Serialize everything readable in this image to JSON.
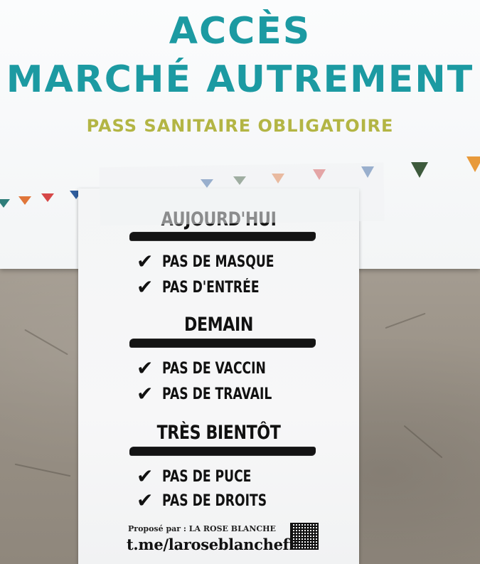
{
  "board": {
    "title_line1": "ACCÈS",
    "title_line2": "MARCHÉ AUTREMENT",
    "subtitle": "PASS SANITAIRE OBLIGATOIRE"
  },
  "flyer": {
    "sections": [
      {
        "heading": "AUJOURD'HUI",
        "items": [
          "PAS DE MASQUE",
          "PAS D'ENTRÉE"
        ]
      },
      {
        "heading": "DEMAIN",
        "items": [
          "PAS DE VACCIN",
          "PAS DE TRAVAIL"
        ]
      },
      {
        "heading": "TRÈS BIENTÔT",
        "items": [
          "PAS DE PUCE",
          "PAS DE DROITS"
        ]
      }
    ],
    "credit": "Proposé par : LA ROSE BLANCHE",
    "handle": "t.me/laroseblanchefr"
  },
  "colors": {
    "title": "#1c9aa2",
    "subtitle": "#b3b544",
    "flags": [
      "#2e7d7a",
      "#e0763a",
      "#d64848",
      "#2f5e9e",
      "#3d5a3c",
      "#e89a3b"
    ]
  }
}
